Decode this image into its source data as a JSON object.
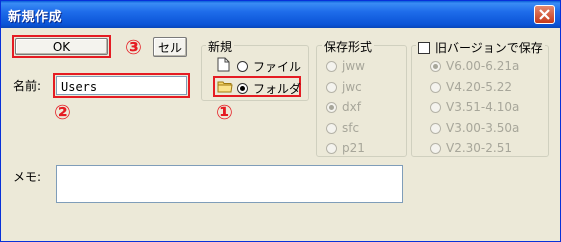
{
  "window": {
    "title": "新規作成",
    "close_label": "×"
  },
  "buttons": {
    "ok_label": "OK",
    "cancel_label": "セル"
  },
  "markers": [
    "①",
    "②",
    "③"
  ],
  "name_field": {
    "label": "名前:",
    "value": "Users"
  },
  "memo_field": {
    "label": "メモ:",
    "value": ""
  },
  "new_group": {
    "title": "新規",
    "options": [
      {
        "label": "ファイル",
        "checked": false,
        "icon": "file-icon"
      },
      {
        "label": "フォルダ",
        "checked": true,
        "icon": "folder-icon"
      }
    ]
  },
  "format_group": {
    "title": "保存形式",
    "options": [
      {
        "label": "jww",
        "checked": false
      },
      {
        "label": "jwc",
        "checked": false
      },
      {
        "label": "dxf",
        "checked": true
      },
      {
        "label": "sfc",
        "checked": false
      },
      {
        "label": "p21",
        "checked": false
      }
    ]
  },
  "old_version_group": {
    "title": "旧バージョンで保存",
    "checked": false,
    "options": [
      {
        "label": "V6.00-6.21a",
        "checked": true
      },
      {
        "label": "V4.20-5.22",
        "checked": false
      },
      {
        "label": "V3.51-4.10a",
        "checked": false
      },
      {
        "label": "V3.00-3.50a",
        "checked": false
      },
      {
        "label": "V2.30-2.51",
        "checked": false
      }
    ]
  },
  "colors": {
    "highlight": "#e51c23",
    "titlebar": "#0a53d6",
    "dialog_bg": "#ece9d8"
  }
}
